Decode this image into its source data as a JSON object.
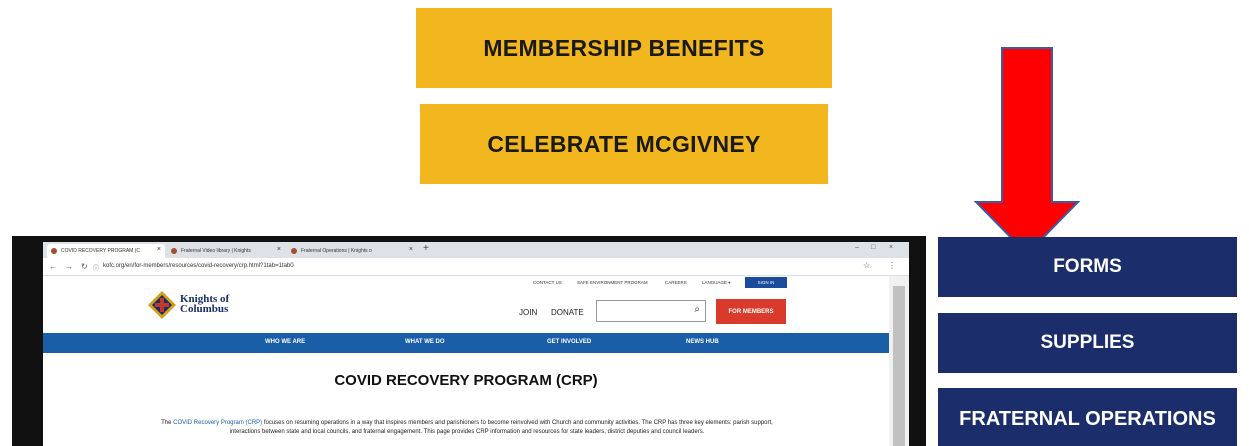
{
  "buttons": {
    "membership_benefits": "MEMBERSHIP BENEFITS",
    "celebrate_mcgivney": "CELEBRATE MCGIVNEY",
    "forms": "FORMS",
    "supplies": "SUPPLIES",
    "fraternal_operations": "FRATERNAL OPERATIONS"
  },
  "colors": {
    "gold": "#f2b71f",
    "navy": "#1b2d6a",
    "arrow_red": "#ff0000",
    "arrow_outline": "#3b5ba8"
  },
  "browser": {
    "tabs": [
      {
        "label": "COVID RECOVERY PROGRAM (C"
      },
      {
        "label": "Fraternal Video library | Knights"
      },
      {
        "label": "Fraternal Operations | Knights o"
      }
    ],
    "url": "kofc.org/en/for-members/resources/covid-recovery/crp.html?1tab=1tab0",
    "top_links": [
      "CONTACT US",
      "SAFE ENVIRONMENT PROGRAM",
      "CAREERS",
      "LANGUAGE"
    ],
    "sign_in": "SIGN IN",
    "logo_line1": "Knights of",
    "logo_line2": "Columbus",
    "join": "JOIN",
    "donate": "DONATE",
    "for_members": "FOR MEMBERS",
    "main_nav": [
      "WHO WE ARE",
      "WHAT WE DO",
      "GET INVOLVED",
      "NEWS HUB"
    ],
    "page_title": "COVID RECOVERY PROGRAM (CRP)",
    "body_prefix": "The ",
    "body_link": "COVID Recovery Program (CRP)",
    "body_text": " focuses on resuming operations in a way that inspires members and parishioners to become reinvolved with Church and community activities. The CRP has three key elements: parish support, interactions between state and local councils, and fraternal engagement. This page provides CRP information and resources for state leaders, district deputies and council leaders."
  }
}
